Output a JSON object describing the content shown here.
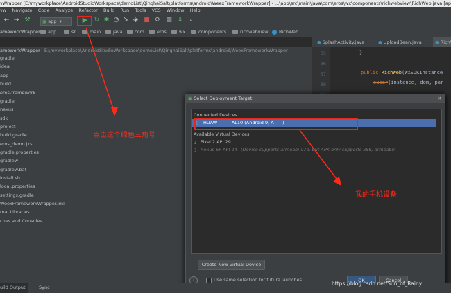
{
  "window_title": "vWrapper [E:\\myworkplace\\AndroidStudioWorkspace\\demoList\\QinghaiSalt\\platforms\\android\\WeexFrameworkWrapper] - ...\\app\\src\\main\\java\\com\\eros\\wx\\components\\richwebview\\RichWeb.java [app]",
  "menu": [
    "vw",
    "Navigate",
    "Code",
    "Analyze",
    "Refactor",
    "Build",
    "Run",
    "Tools",
    "VCS",
    "Window",
    "Help"
  ],
  "toolbar": {
    "config": "app"
  },
  "breadcrumb": [
    "ameworkWrapper",
    "app",
    "sr",
    "main",
    "java",
    "com",
    "eros",
    "wx",
    "components",
    "richwebview",
    "RichWeb"
  ],
  "tabs": [
    "SplashActivity.java",
    "UploadBean.java",
    "RichWeb"
  ],
  "project": {
    "root_name": "ameworkWrapper",
    "root_path": "E:\\myworkplace\\AndroidStudioWorkspace\\demoList\\QinghaiSalt\\platforms\\android\\WeexFrameworkWrapper",
    "items": [
      "gradle",
      "idea",
      "app",
      "build",
      "eros-framework",
      "gradle",
      "nexus",
      "sdk",
      "project",
      "build.gradle",
      "eros_demo.jks",
      "gradle.properties",
      "gradlew",
      "gradlew.bat",
      "install.sh",
      "local.properties",
      "settings.gradle",
      "WeexFrameworkWrapper.iml",
      "rnal Libraries",
      "ches and Consoles"
    ]
  },
  "editor": {
    "line_numbers": [
      "35",
      "36",
      "37",
      "38",
      "39",
      "40",
      "41"
    ],
    "line1": "}",
    "line2_kw": "public",
    "line2_name": "RichWeb",
    "line2_rest": "(WXSDKInstance",
    "line3_super": "super",
    "line3_rest": "(instance, dom, par"
  },
  "dialog": {
    "title": "Select Deployment Target",
    "connected_header": "Connected Devices",
    "connected_device": "HUAW          AL10 (Android 9, A      )",
    "virtual_header": "Available Virtual Devices",
    "virtual_devices": [
      {
        "name": "Pixel 2 API 29",
        "note": ""
      },
      {
        "name": "Nexus 6P API 24",
        "note": "(Device supports armeabi-v7a, but APK only supports x86, armeabi)"
      }
    ],
    "create_button": "Create New Virtual Device",
    "checkbox_label": "Use same selection for future launches",
    "ok_button": "OK",
    "cancel_button": "Cancel"
  },
  "bottom": {
    "tab1": "uild Output",
    "tab2": "Sync",
    "watermark": "https://blog.csdn.net/Sun_of_Rainy"
  },
  "annotations": {
    "green_triangle": "点击这个绿色三角号",
    "my_phone": "我的手机设备"
  },
  "colors": {
    "accent_red": "#ff2a1a",
    "run_green": "#59a869",
    "selection_blue": "#4b6eaf",
    "dialog_bg": "#3c3f41"
  }
}
